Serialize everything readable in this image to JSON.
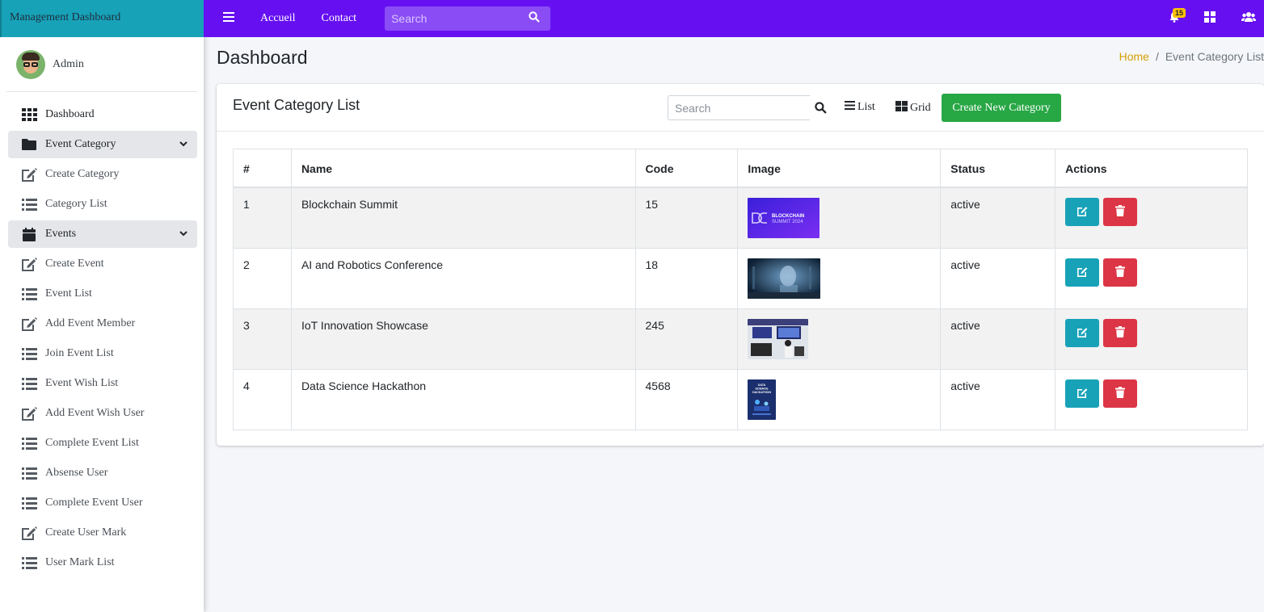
{
  "brand": "Management Dashboard",
  "user": {
    "name": "Admin"
  },
  "sidebar": {
    "items": [
      {
        "label": "Dashboard",
        "icon": "grid-icon",
        "kind": "top"
      },
      {
        "label": "Event Category",
        "icon": "folder-icon",
        "kind": "group"
      },
      {
        "label": "Create Category",
        "icon": "edit-icon",
        "kind": "sub"
      },
      {
        "label": "Category List",
        "icon": "list-icon",
        "kind": "sub"
      },
      {
        "label": "Events",
        "icon": "calendar-icon",
        "kind": "group"
      },
      {
        "label": "Create Event",
        "icon": "edit-icon",
        "kind": "sub"
      },
      {
        "label": "Event List",
        "icon": "list-icon",
        "kind": "sub"
      },
      {
        "label": "Add Event Member",
        "icon": "edit-icon",
        "kind": "sub"
      },
      {
        "label": "Join Event List",
        "icon": "list-icon",
        "kind": "sub"
      },
      {
        "label": "Event Wish List",
        "icon": "list-icon",
        "kind": "sub"
      },
      {
        "label": "Add Event Wish User",
        "icon": "edit-icon",
        "kind": "sub"
      },
      {
        "label": "Complete Event List",
        "icon": "list-icon",
        "kind": "sub"
      },
      {
        "label": "Absense User",
        "icon": "list-icon",
        "kind": "sub"
      },
      {
        "label": "Complete Event User",
        "icon": "list-icon",
        "kind": "sub"
      },
      {
        "label": "Create User Mark",
        "icon": "edit-icon",
        "kind": "sub"
      },
      {
        "label": "User Mark List",
        "icon": "list-icon",
        "kind": "sub"
      }
    ]
  },
  "topbar": {
    "links": [
      "Accueil",
      "Contact"
    ],
    "search_placeholder": "Search",
    "notification_count": "15"
  },
  "header": {
    "title": "Dashboard",
    "breadcrumb_home": "Home",
    "breadcrumb_separator": "/",
    "breadcrumb_current": "Event Category List"
  },
  "card": {
    "title": "Event Category List",
    "search_placeholder": "Search",
    "list_label": "List",
    "grid_label": "Grid",
    "create_label": "Create New Category"
  },
  "table": {
    "columns": [
      "#",
      "Name",
      "Code",
      "Image",
      "Status",
      "Actions"
    ],
    "rows": [
      {
        "num": "1",
        "name": "Blockchain Summit",
        "code": "15",
        "status": "active",
        "image": {
          "line1": "BLOCKCHAIN",
          "line2": "SUMMIT 2024"
        }
      },
      {
        "num": "2",
        "name": "AI and Robotics Conference",
        "code": "18",
        "status": "active",
        "image": {}
      },
      {
        "num": "3",
        "name": "IoT Innovation Showcase",
        "code": "245",
        "status": "active",
        "image": {}
      },
      {
        "num": "4",
        "name": "Data Science Hackathon",
        "code": "4568",
        "status": "active",
        "image": {
          "line1": "DATA",
          "line2": "SCIENCE",
          "line3": "HACKATHON"
        }
      }
    ]
  },
  "colors": {
    "topbar": "#6610f2",
    "brand": "#17a2b8",
    "create": "#28a745",
    "edit": "#17a2b8",
    "delete": "#dc3545",
    "breadcrumb_home": "#d4a106"
  }
}
